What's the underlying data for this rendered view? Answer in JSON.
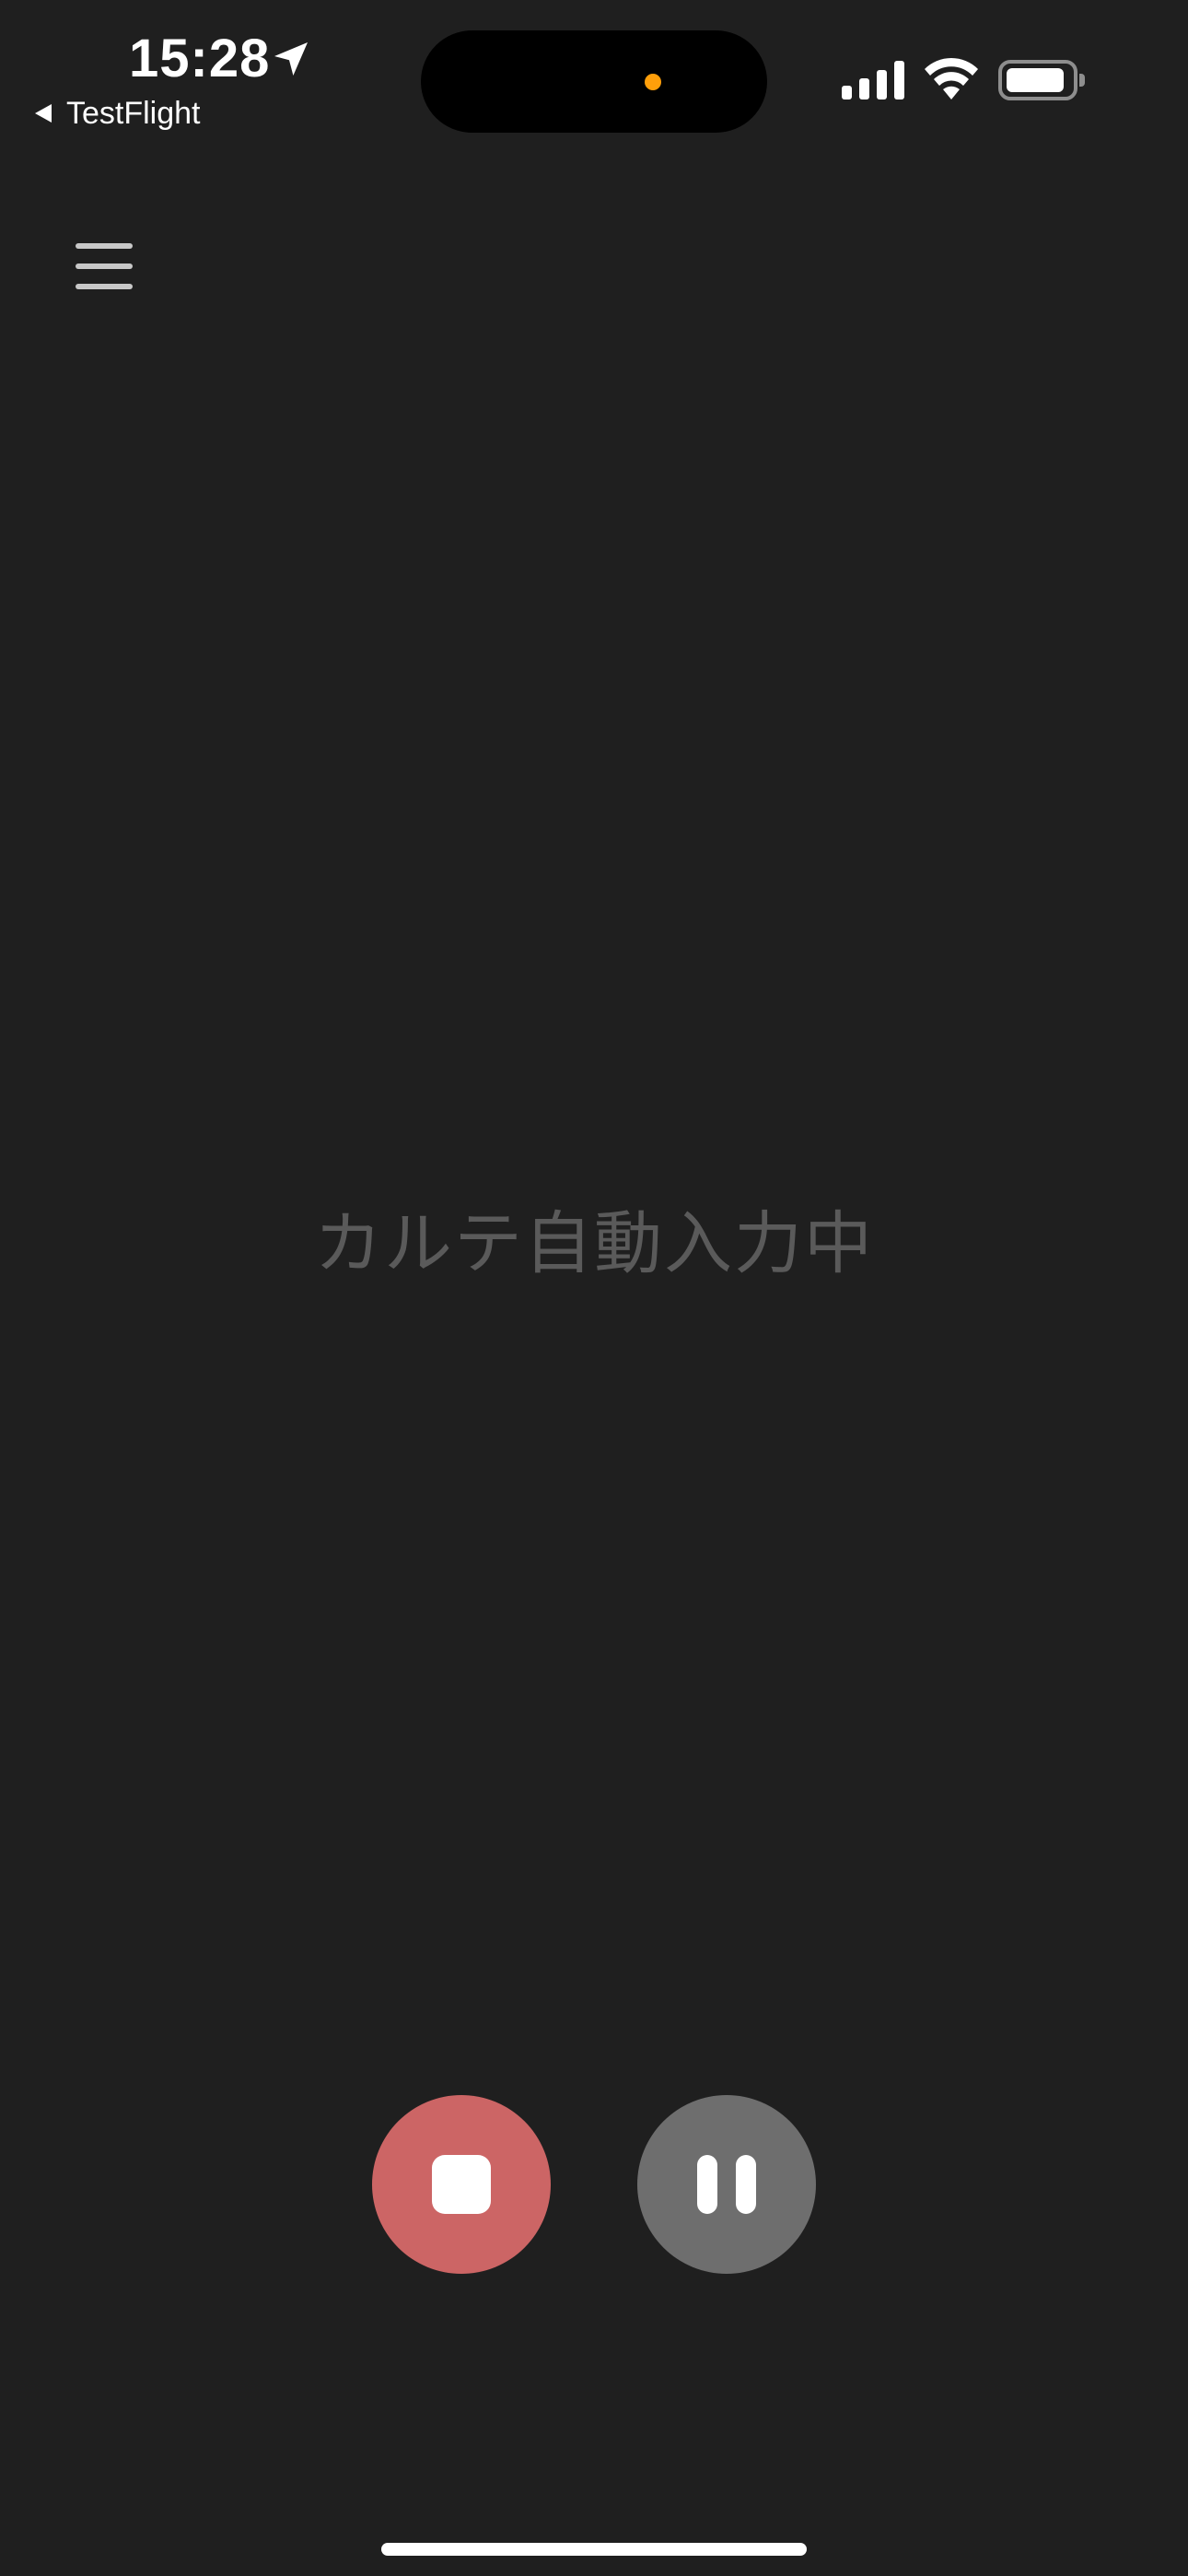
{
  "status_bar": {
    "time": "15:28",
    "back_app_label": "TestFlight",
    "icons": [
      "location-arrow-icon",
      "cellular-signal-icon",
      "wifi-icon",
      "battery-icon"
    ],
    "privacy_indicator_color": "#ff9f0a"
  },
  "header": {
    "menu_icon": "hamburger-menu-icon"
  },
  "main": {
    "status_message": "カルテ自動入力中"
  },
  "controls": {
    "stop_icon": "stop-icon",
    "stop_color": "#cc6565",
    "pause_icon": "pause-icon",
    "pause_color": "#6e6e6e"
  },
  "theme": {
    "background": "#1f1f1f",
    "status_text_color": "#5a5a5a"
  }
}
